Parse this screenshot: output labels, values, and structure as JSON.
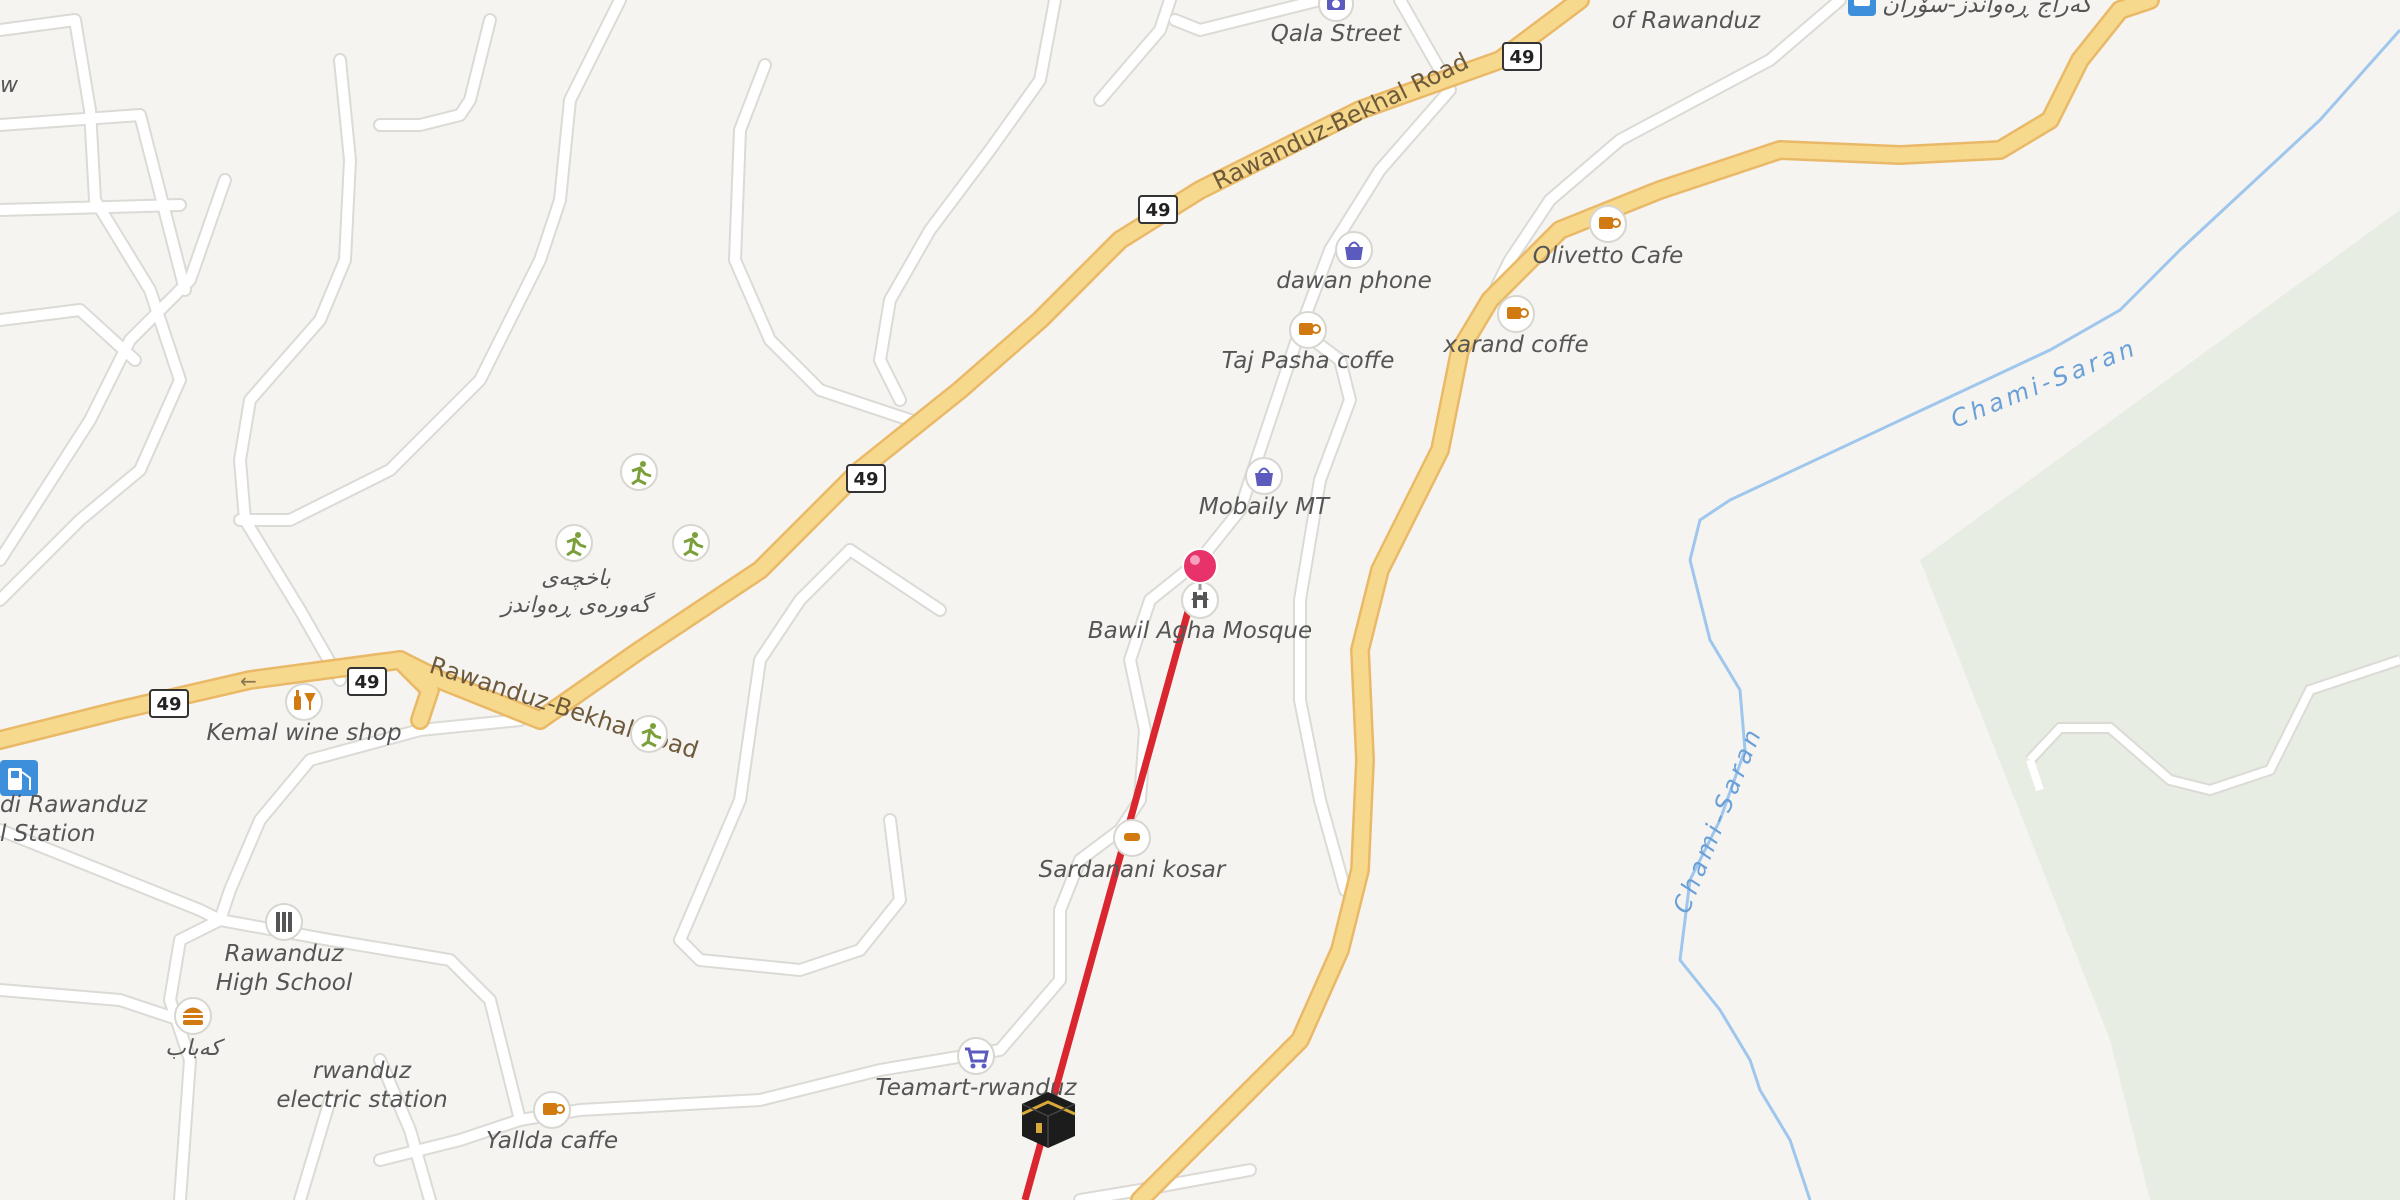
{
  "map": {
    "colors": {
      "background": "#f6f4f1",
      "park": "#e7ede2",
      "major_road": "#f7d98e",
      "major_road_casing": "#e9b968",
      "minor_road": "#ffffff",
      "minor_road_casing": "#dcdad5",
      "water": "#9fc6ec",
      "route_line": "#d9262f",
      "pin": "#e8336a",
      "poi_food": "#d17a12",
      "poi_shop": "#5b5bbd",
      "poi_leisure": "#7ba03a",
      "poi_transport": "#3d8fdc"
    },
    "roads": {
      "main_name_1": "Rawanduz-Bekhal Road",
      "main_name_2": "Rawanduz-Bekhal Road",
      "shield_number": "49"
    },
    "waterways": {
      "stream_name_1": "Chami-Saran",
      "stream_name_2": "Chami-Saran"
    },
    "places": {
      "qala_street": "Qala Street",
      "of_rawanduz": "of Rawanduz",
      "bus_station": "گەراج ڕەواندز-سۆران",
      "dawan_phone": "dawan phone",
      "olivetto_cafe": "Olivetto Cafe",
      "taj_pasha": "Taj Pasha coffe",
      "xarand": "xarand coffe",
      "mobaily": "Mobaily MT",
      "mosque": "Bawil Agha Mosque",
      "sardanani": "Sardanani kosar",
      "teamart": "Teamart-rwanduz",
      "garden_line1": "باخچەی",
      "garden_line2": "گەورەی ڕەواندز",
      "kemal": "Kemal wine shop",
      "fuel_line1": "di Rawanduz",
      "fuel_line2": "l Station",
      "school_line1": "Rawanduz",
      "school_line2": "High School",
      "kebab": "کەباب",
      "electric_line1": "rwanduz",
      "electric_line2": "electric station",
      "yallda": "Yallda caffe",
      "edge_w": "w"
    }
  }
}
